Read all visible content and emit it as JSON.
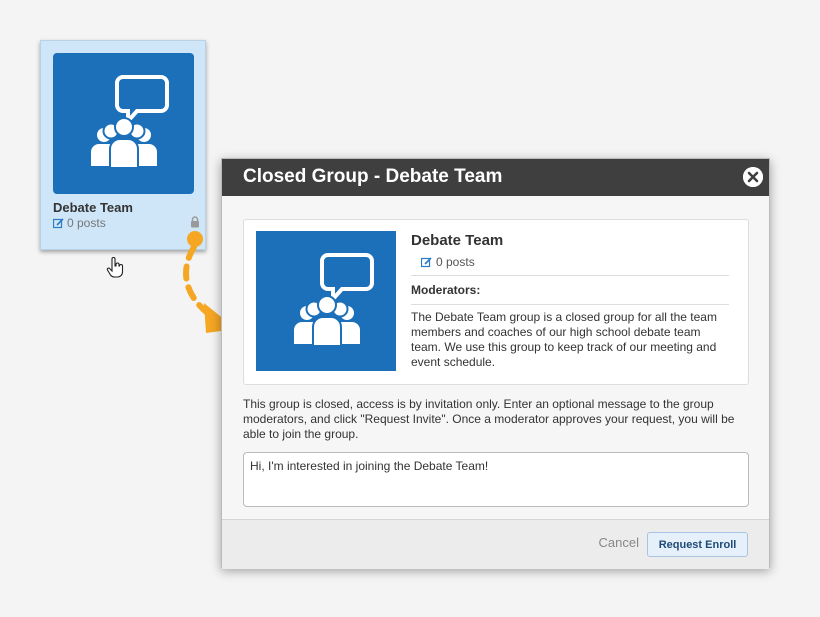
{
  "card": {
    "title": "Debate Team",
    "posts": "0 posts",
    "icons": [
      "group-chat-icon",
      "edit-icon",
      "lock-icon",
      "hand-cursor-icon"
    ]
  },
  "modal": {
    "title": "Closed Group - Debate Team",
    "group_title": "Debate Team",
    "posts": "0 posts",
    "moderators_label": "Moderators:",
    "description": "The Debate Team group is a closed group for all the team members and coaches of our high school debate team team.  We use this group to keep track of our meeting and event schedule.",
    "notice": "This group is closed, access is by invitation only. Enter an optional message to the group moderators, and click \"Request Invite\". Once a moderator approves your request, you will be able to join the group.",
    "message_value": "Hi, I'm interested in joining the Debate Team!",
    "cancel_label": "Cancel",
    "enroll_label": "Request Enroll"
  },
  "colors": {
    "brand_blue": "#1c70ba",
    "card_bg": "#cfe6f8",
    "header_bg": "#3f3f3f",
    "arrow": "#f5a623"
  }
}
